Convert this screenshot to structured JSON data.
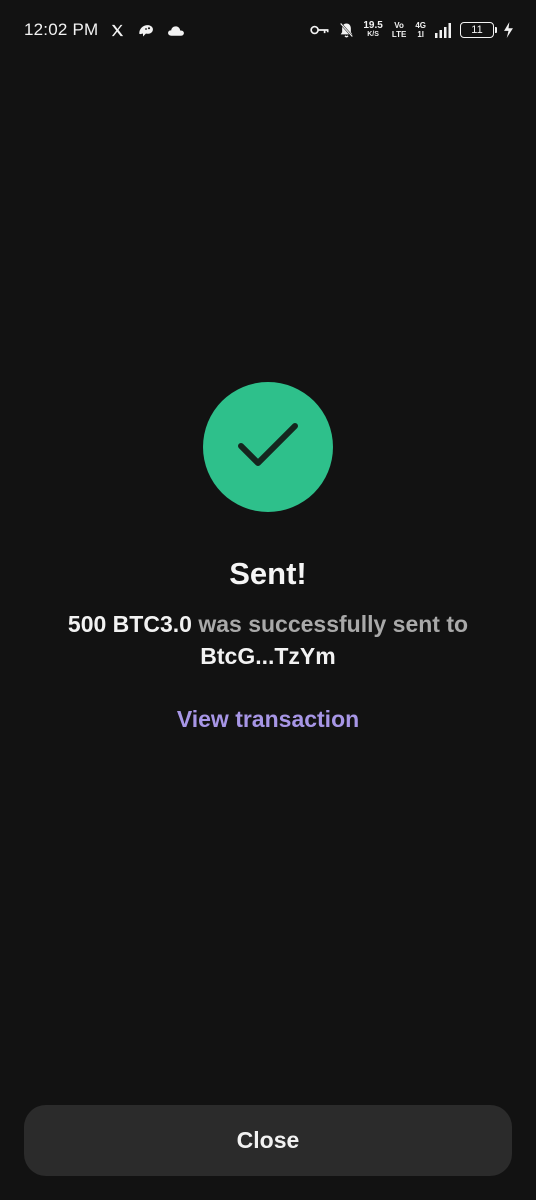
{
  "status_bar": {
    "time": "12:02 PM",
    "net_speed_value": "19.5",
    "net_speed_unit": "K/S",
    "volte_top": "Vo",
    "volte_bottom": "LTE",
    "network_top": "4G",
    "network_bottom": "1l",
    "battery_level": "11",
    "icons": [
      "x-icon",
      "bird-icon",
      "cloud-icon",
      "key-icon",
      "bell-off-icon",
      "signal-icon",
      "battery-icon",
      "charging-icon"
    ]
  },
  "result": {
    "title": "Sent!",
    "amount": "500 BTC3.0",
    "message_mid": " was successfully sent to ",
    "recipient": "BtcG...TzYm",
    "link": "View transaction"
  },
  "footer": {
    "close_label": "Close"
  },
  "colors": {
    "background": "#121212",
    "success": "#2ec08b",
    "link": "#a796e6",
    "button": "#2b2b2b"
  }
}
